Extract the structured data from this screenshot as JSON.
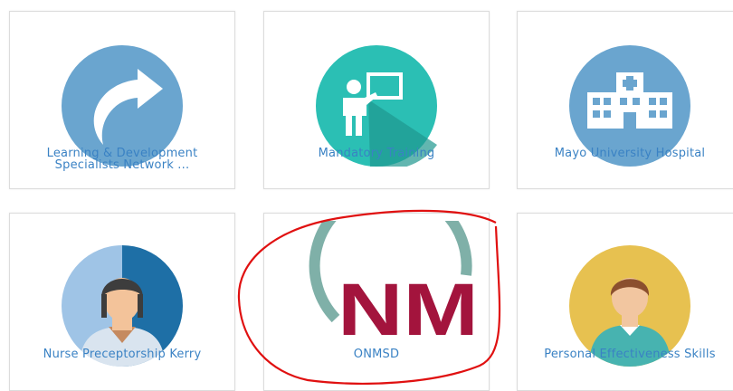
{
  "tiles": [
    {
      "label": "Learning & Development Specialists Network ...",
      "icon": "curved-arrow-icon"
    },
    {
      "label": "Mandatory Training",
      "icon": "teacher-board-icon"
    },
    {
      "label": "Mayo University Hospital",
      "icon": "hospital-building-icon"
    },
    {
      "label": "Nurse Preceptorship Kerry",
      "icon": "nurse-avatar-icon"
    },
    {
      "label": "ONMSD",
      "icon": "onmsd-logo-icon",
      "logo_text": "NM"
    },
    {
      "label": "Personal Effectiveness Skills",
      "icon": "person-avatar-icon"
    }
  ],
  "annotation": {
    "type": "hand-drawn-circle",
    "color": "#e01010"
  },
  "colors": {
    "label": "#3a82c4",
    "circle_blue": "#6aa5cf",
    "circle_teal": "#2bbfb4",
    "circle_gold": "#e7c150",
    "logo_teal": "#7fb0a8",
    "logo_maroon": "#a3143d"
  }
}
